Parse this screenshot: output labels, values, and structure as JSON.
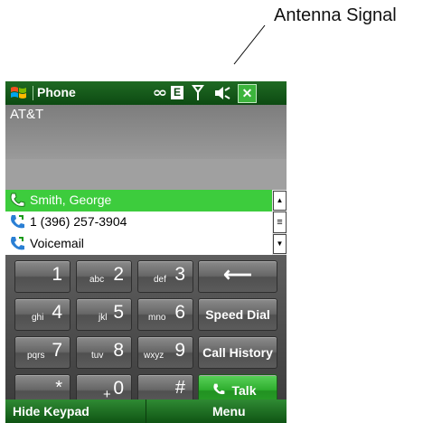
{
  "annotation": {
    "label": "Antenna Signal"
  },
  "statusbar": {
    "app_title": "Phone",
    "voicemail_glyph": "ᴑᴑ",
    "data_badge": "E",
    "close_label": "✕",
    "icons": [
      "windows-start-icon",
      "voicemail-icon",
      "edge-data-icon",
      "antenna-signal-icon",
      "speaker-icon",
      "close-icon"
    ]
  },
  "carrier": {
    "name": "AT&T"
  },
  "contacts": [
    {
      "label": "Smith, George",
      "selected": true
    },
    {
      "label": "1 (396) 257-3904",
      "selected": false
    },
    {
      "label": "Voicemail",
      "selected": false
    }
  ],
  "scrollbar": {
    "up": "▲",
    "thumb": "≡",
    "down": "▼"
  },
  "keypad": {
    "row1": {
      "k1_digit": "1",
      "k2_letters": "abc",
      "k2_digit": "2",
      "k3_letters": "def",
      "k3_digit": "3",
      "backspace": "⟵"
    },
    "row2": {
      "k4_letters": "ghi",
      "k4_digit": "4",
      "k5_letters": "jkl",
      "k5_digit": "5",
      "k6_letters": "mno",
      "k6_digit": "6",
      "speed_dial": "Speed Dial"
    },
    "row3": {
      "k7_letters": "pqrs",
      "k7_digit": "7",
      "k8_letters": "tuv",
      "k8_digit": "8",
      "k9_letters": "wxyz",
      "k9_digit": "9",
      "call_history": "Call History"
    },
    "row4": {
      "star": "*",
      "plus": "+",
      "zero": "0",
      "hash": "#",
      "talk": "Talk"
    }
  },
  "softkeys": {
    "left": "Hide Keypad",
    "right": "Menu"
  },
  "colors": {
    "titlebar": "#0d4a12",
    "selection": "#3dcc3d",
    "talk": "#2fae2f"
  }
}
